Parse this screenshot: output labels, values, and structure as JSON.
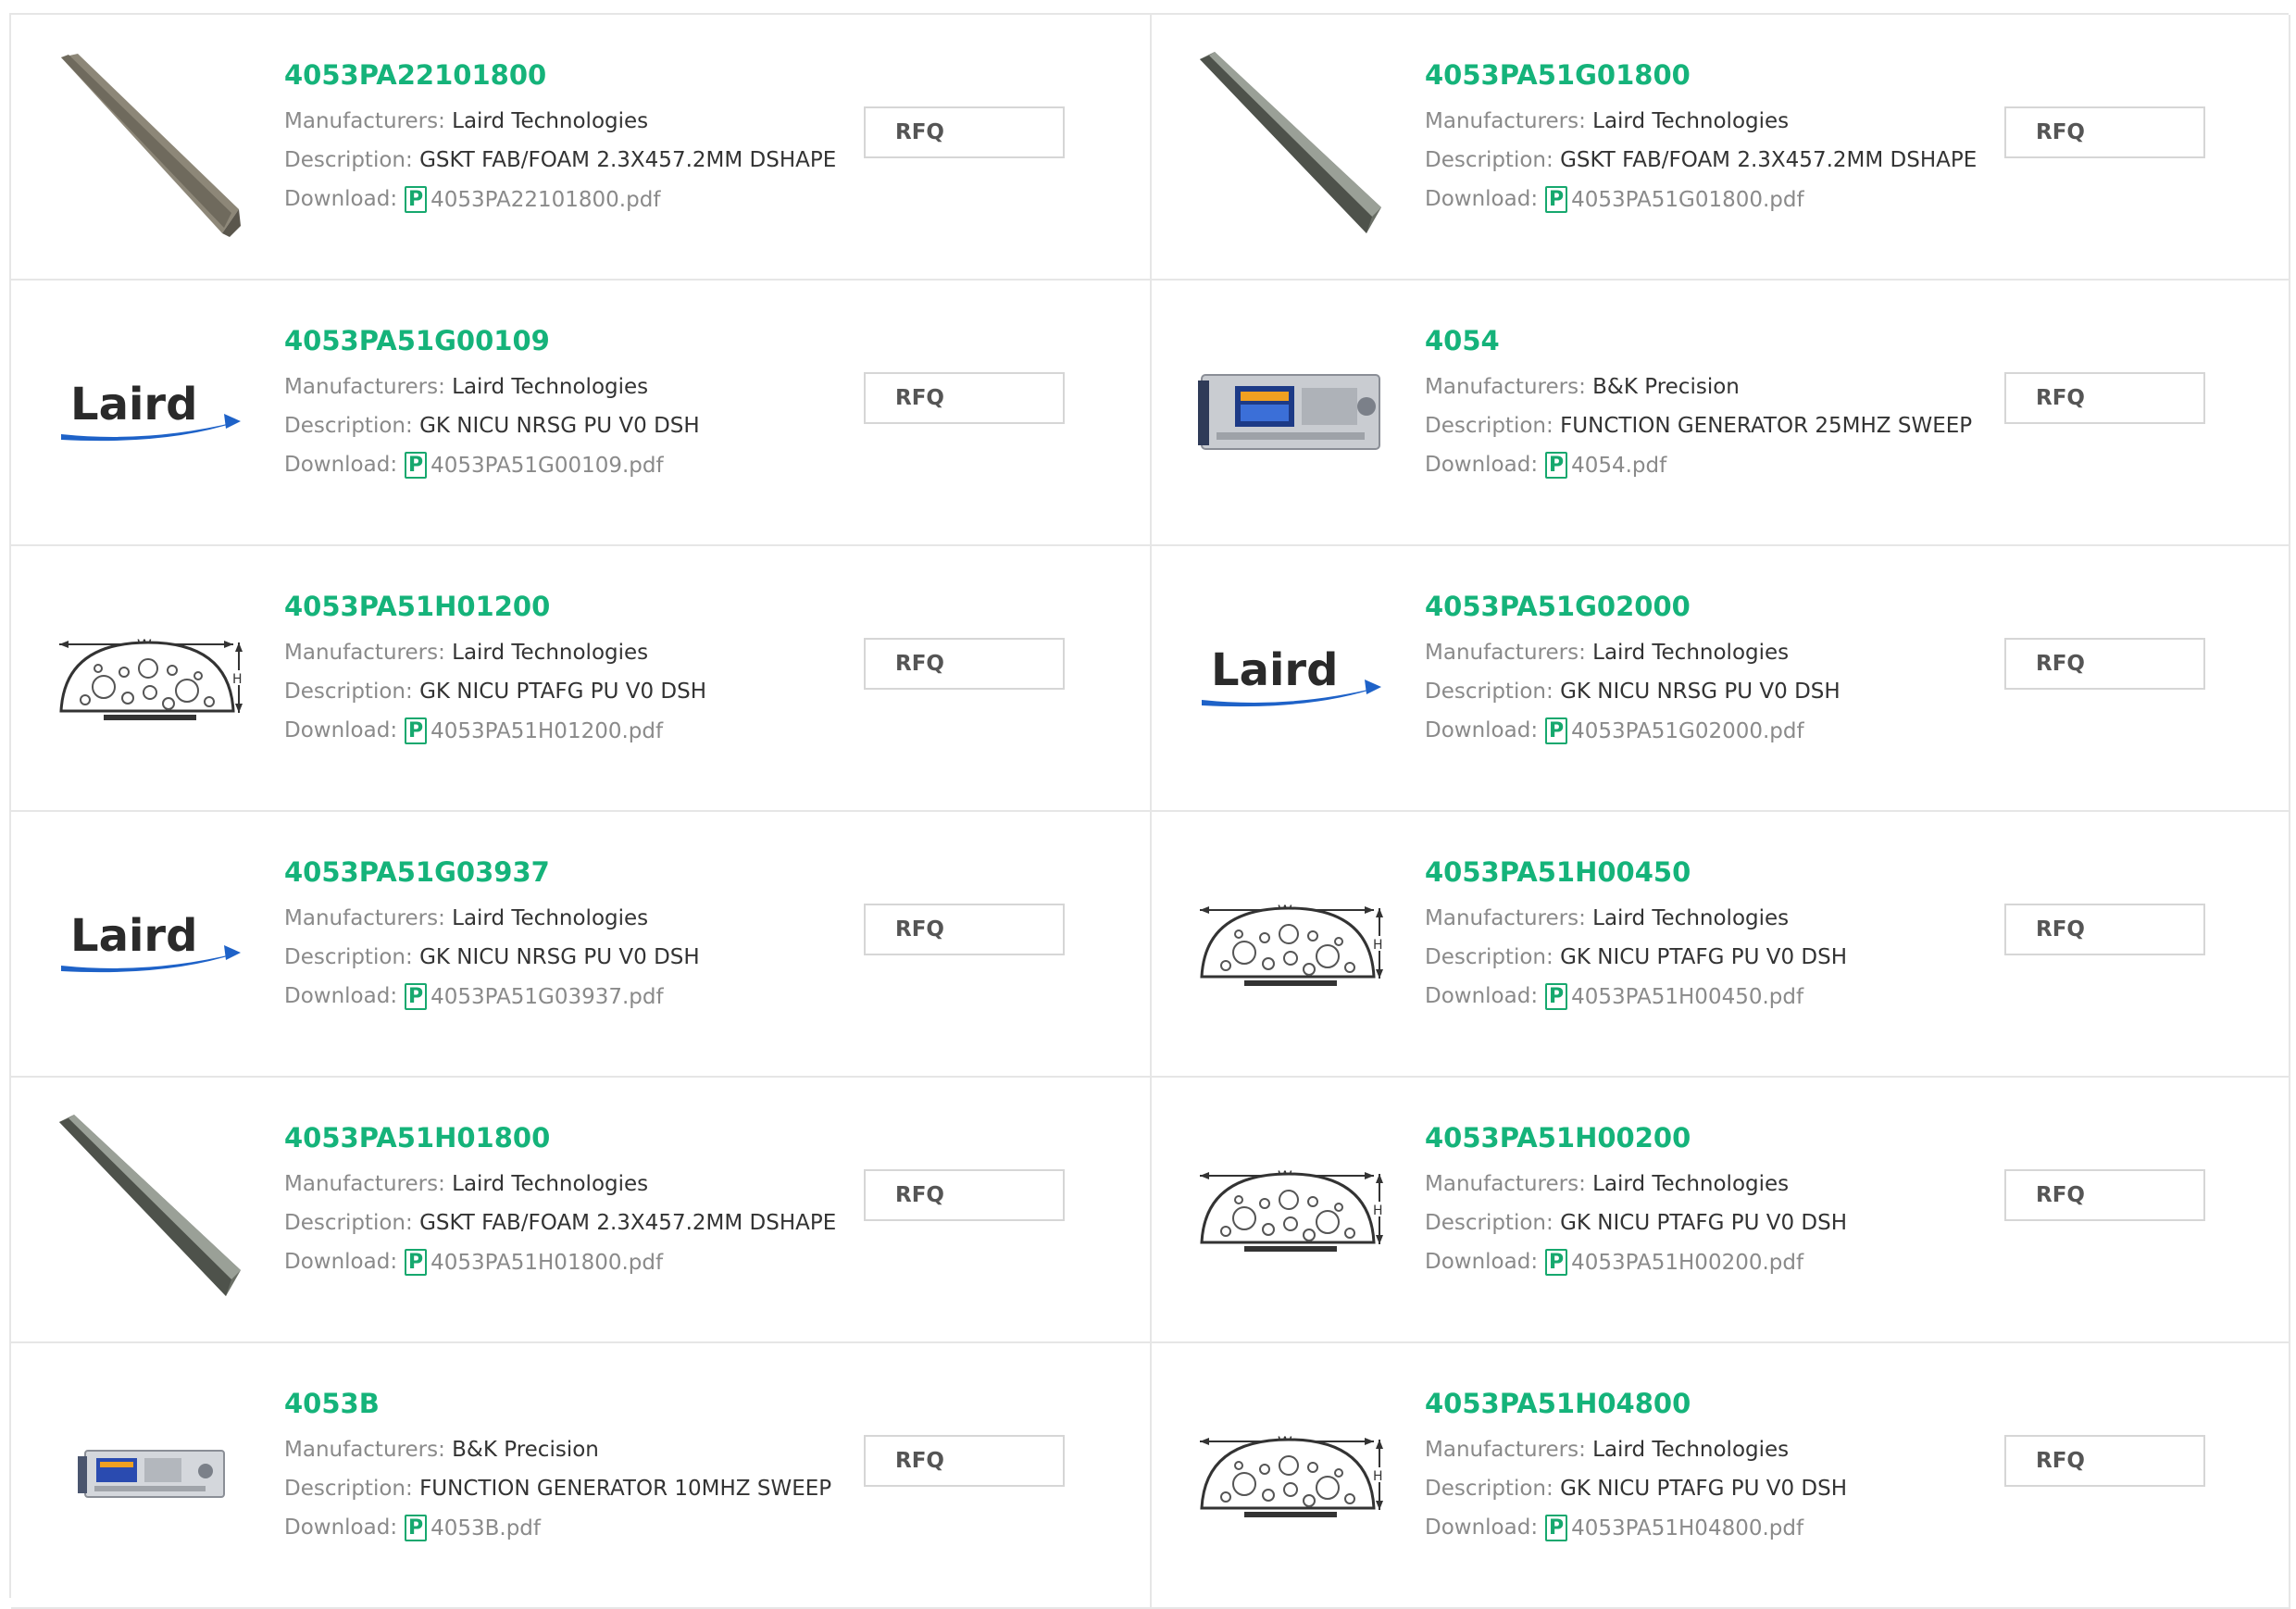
{
  "labels": {
    "manufacturers": "Manufacturers:",
    "description": "Description:",
    "download": "Download:",
    "rfq": "RFQ",
    "pdf_glyph": "P"
  },
  "logo_text": "Laird",
  "colors": {
    "part_number": "#15b37a",
    "pdf_icon": "#16a86e",
    "border": "#e6e6e6",
    "logo_blue": "#1e62c8"
  },
  "products": [
    {
      "part": "4053PA22101800",
      "manufacturer": "Laird Technologies",
      "description": "GSKT FAB/FOAM 2.3X457.2MM DSHAPE",
      "file": "4053PA22101800.pdf",
      "image": "gasket-strip-dark"
    },
    {
      "part": "4053PA51G01800",
      "manufacturer": "Laird Technologies",
      "description": "GSKT FAB/FOAM 2.3X457.2MM DSHAPE",
      "file": "4053PA51G01800.pdf",
      "image": "gasket-strip-light"
    },
    {
      "part": "4053PA51G00109",
      "manufacturer": "Laird Technologies",
      "description": "GK NICU NRSG PU V0 DSH",
      "file": "4053PA51G00109.pdf",
      "image": "laird-logo"
    },
    {
      "part": "4054",
      "manufacturer": "B&K Precision",
      "description": "FUNCTION GENERATOR 25MHZ SWEEP",
      "file": "4054.pdf",
      "image": "function-generator-large"
    },
    {
      "part": "4053PA51H01200",
      "manufacturer": "Laird Technologies",
      "description": "GK NICU PTAFG PU V0 DSH",
      "file": "4053PA51H01200.pdf",
      "image": "dshape-diagram"
    },
    {
      "part": "4053PA51G02000",
      "manufacturer": "Laird Technologies",
      "description": "GK NICU NRSG PU V0 DSH",
      "file": "4053PA51G02000.pdf",
      "image": "laird-logo"
    },
    {
      "part": "4053PA51G03937",
      "manufacturer": "Laird Technologies",
      "description": "GK NICU NRSG PU V0 DSH",
      "file": "4053PA51G03937.pdf",
      "image": "laird-logo"
    },
    {
      "part": "4053PA51H00450",
      "manufacturer": "Laird Technologies",
      "description": "GK NICU PTAFG PU V0 DSH",
      "file": "4053PA51H00450.pdf",
      "image": "dshape-diagram"
    },
    {
      "part": "4053PA51H01800",
      "manufacturer": "Laird Technologies",
      "description": "GSKT FAB/FOAM 2.3X457.2MM DSHAPE",
      "file": "4053PA51H01800.pdf",
      "image": "gasket-strip-light"
    },
    {
      "part": "4053PA51H00200",
      "manufacturer": "Laird Technologies",
      "description": "GK NICU PTAFG PU V0 DSH",
      "file": "4053PA51H00200.pdf",
      "image": "dshape-diagram"
    },
    {
      "part": "4053B",
      "manufacturer": "B&K Precision",
      "description": "FUNCTION GENERATOR 10MHZ SWEEP",
      "file": "4053B.pdf",
      "image": "function-generator-small"
    },
    {
      "part": "4053PA51H04800",
      "manufacturer": "Laird Technologies",
      "description": "GK NICU PTAFG PU V0 DSH",
      "file": "4053PA51H04800.pdf",
      "image": "dshape-diagram"
    }
  ]
}
